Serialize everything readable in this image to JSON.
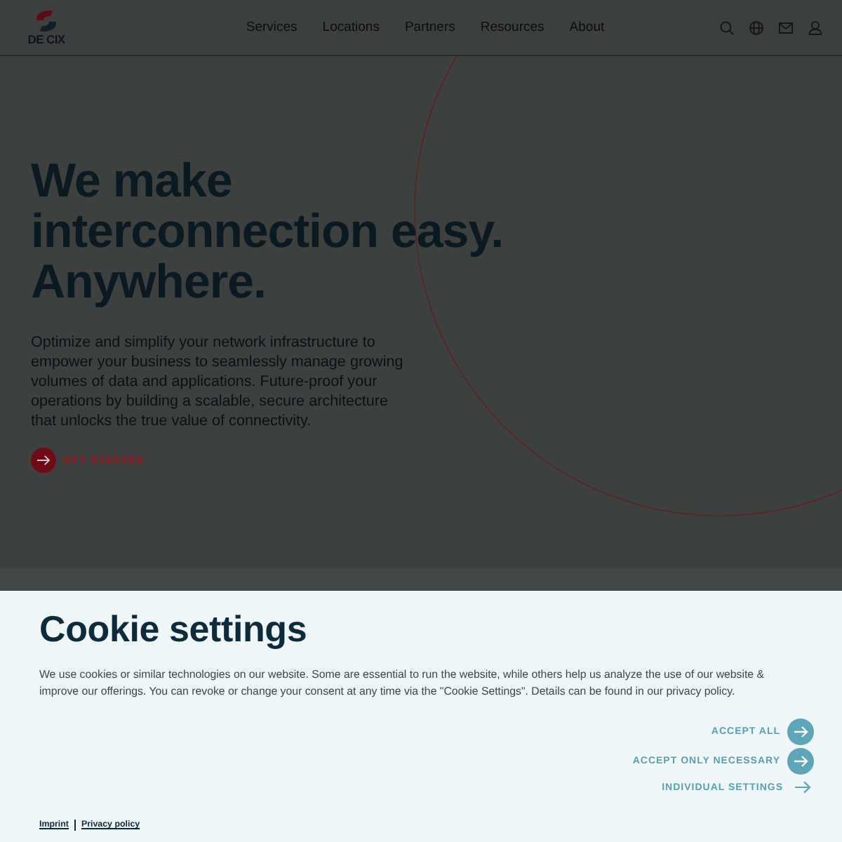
{
  "header": {
    "logo_text": "DE CIX",
    "nav": [
      "Services",
      "Locations",
      "Partners",
      "Resources",
      "About"
    ]
  },
  "hero": {
    "title": "We make interconnection easy. Anywhere.",
    "description": "Optimize and simplify your network infrastructure to empower your business to seamlessly manage growing volumes of data and applications. Future-proof your operations by building a scalable, secure architecture that unlocks the true value of connectivity.",
    "cta": {
      "label": "GET STARTED"
    }
  },
  "cookie_dialog": {
    "title": "Cookie settings",
    "text": "We use cookies or similar technologies on our website. Some are essential to run the website, while others help us analyze the use of our website & improve our offerings. You can revoke or change your consent at any time via the \"Cookie Settings\". Details can be found in our privacy policy.",
    "actions": [
      {
        "label": "ACCEPT ALL",
        "kind": "filled"
      },
      {
        "label": "ACCEPT ONLY NECESSARY",
        "kind": "filled"
      },
      {
        "label": "INDIVIDUAL SETTINGS",
        "kind": "plain"
      }
    ],
    "links": [
      "Imprint",
      "Privacy policy"
    ]
  }
}
